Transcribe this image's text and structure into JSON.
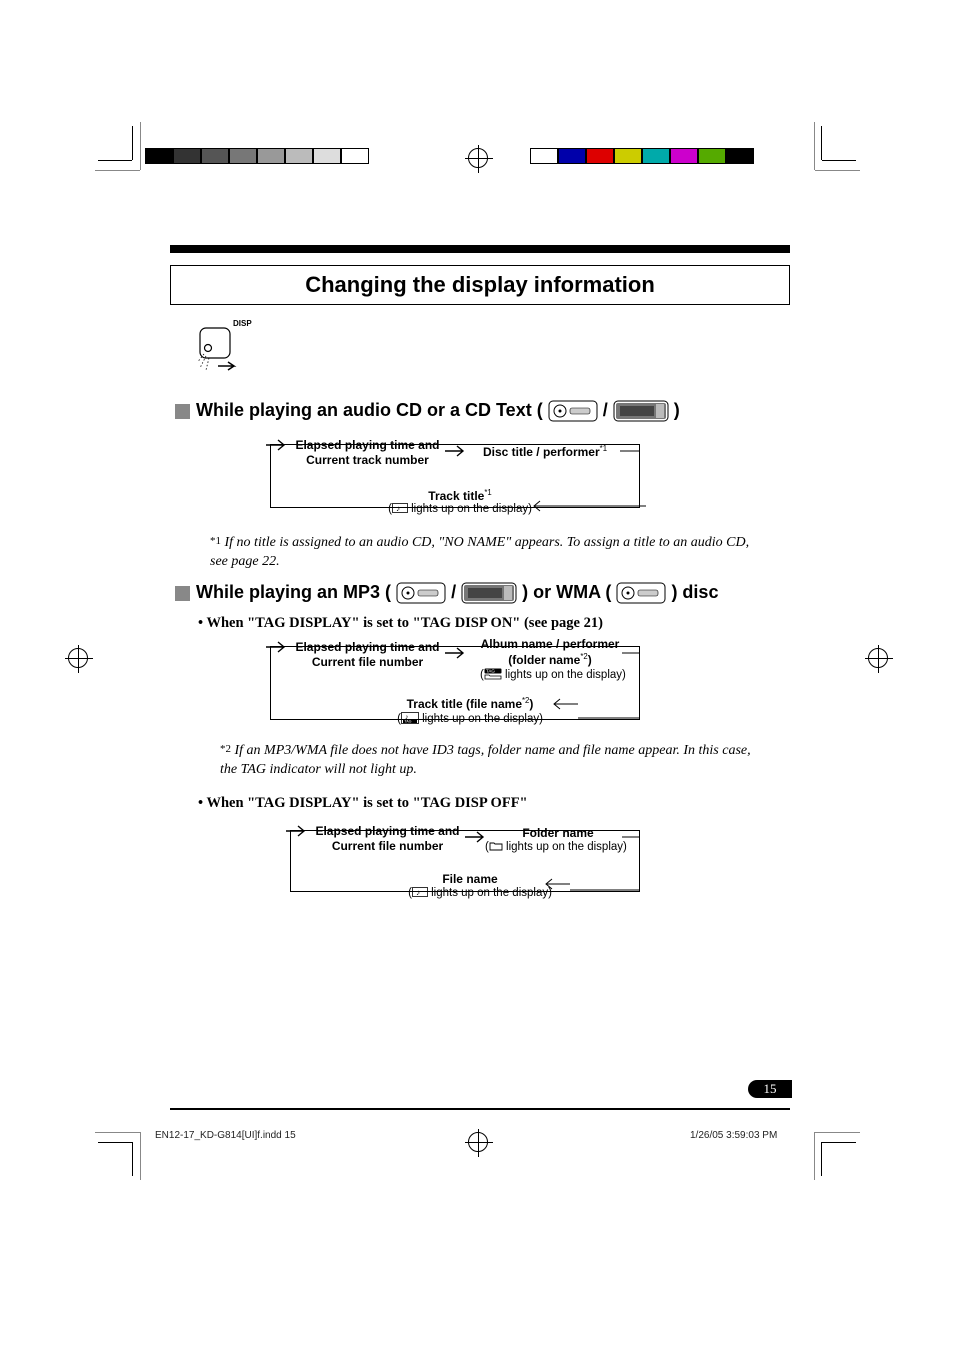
{
  "title": "Changing the display information",
  "disp_button_label": "DISP",
  "section1": {
    "prefix": "While playing an audio CD or a CD Text (",
    "suffix": " )",
    "sep": " / "
  },
  "flow1": {
    "a_line1": "Elapsed playing time and",
    "a_line2": "Current track number",
    "b": "Disc title / performer",
    "b_sup": "*1",
    "c": "Track title",
    "c_sup": "*1",
    "c_note": " lights up on the display)"
  },
  "footnote1": {
    "mark": "*1",
    "text": "If no title is assigned to an audio CD, \"NO NAME\" appears. To assign a title to an audio CD, see page 22."
  },
  "section2": {
    "prefix": "While playing an MP3 (",
    "mid": " ) or WMA (",
    "suffix": " ) disc",
    "sep": " / "
  },
  "bullet2a": "• When \"TAG DISPLAY\" is set to \"TAG DISP ON\" (see page 21)",
  "flow2": {
    "a_line1": "Elapsed playing time and",
    "a_line2": "Current file number",
    "b_line1": "Album name / performer",
    "b_line2_prefix": "(folder name",
    "b_line2_sup": "*2",
    "b_line2_suffix": ")",
    "b_note": " lights up on the display)",
    "c_prefix": "Track title (file name",
    "c_sup": "*2",
    "c_suffix": ")",
    "c_note": " lights up on the display)"
  },
  "footnote2": {
    "mark": "*2",
    "text": "If an MP3/WMA file does not have ID3 tags, folder name and file name appear. In this case, the TAG indicator will not light up."
  },
  "bullet2b": "• When \"TAG DISPLAY\" is set to \"TAG DISP OFF\"",
  "flow3": {
    "a_line1": "Elapsed playing time and",
    "a_line2": "Current file number",
    "b_line1": "Folder name",
    "b_note": " lights up on the display)",
    "c": "File name",
    "c_note": " lights up on the display)"
  },
  "page_number": "15",
  "footer_left": "EN12-17_KD-G814[UI]f.indd   15",
  "footer_right": "1/26/05   3:59:03 PM",
  "colorbar_left": [
    "#000",
    "#333",
    "#555",
    "#777",
    "#999",
    "#bbb",
    "#ddd",
    "#fff"
  ],
  "colorbar_right": [
    "#fff",
    "#00a",
    "#d00",
    "#cc0",
    "#0aa",
    "#c0c",
    "#5a0",
    "#000"
  ]
}
